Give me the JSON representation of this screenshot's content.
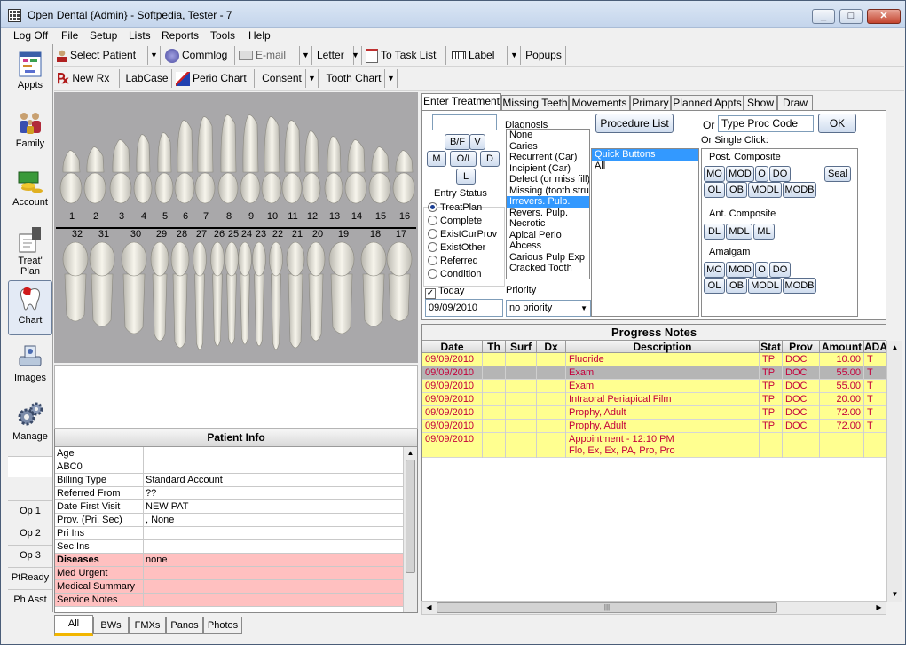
{
  "window": {
    "title": "Open Dental {Admin} - Softpedia, Tester - 7",
    "controls": [
      "_",
      "□",
      "✕"
    ]
  },
  "menu": [
    "Log Off",
    "File",
    "Setup",
    "Lists",
    "Reports",
    "Tools",
    "Help"
  ],
  "toolbar1": {
    "select_patient": "Select Patient",
    "commlog": "Commlog",
    "email": "E-mail",
    "letter": "Letter",
    "to_task_list": "To Task List",
    "label": "Label",
    "popups": "Popups"
  },
  "toolbar2": {
    "new_rx": "New Rx",
    "labcase": "LabCase",
    "perio_chart": "Perio Chart",
    "consent": "Consent",
    "tooth_chart": "Tooth Chart"
  },
  "modules": [
    {
      "label": "Appts",
      "icon": "calendar-icon"
    },
    {
      "label": "Family",
      "icon": "family-icon"
    },
    {
      "label": "Account",
      "icon": "money-icon"
    },
    {
      "label": "Treat' Plan",
      "icon": "treatplan-icon"
    },
    {
      "label": "Chart",
      "icon": "tooth-icon",
      "selected": true
    },
    {
      "label": "Images",
      "icon": "scanner-icon"
    },
    {
      "label": "Manage",
      "icon": "gears-icon"
    }
  ],
  "op_buttons": [
    "Op 1",
    "Op 2",
    "Op 3",
    "PtReady",
    "Ph Asst"
  ],
  "tooth_numbers": {
    "upper": [
      "1",
      "2",
      "3",
      "4",
      "5",
      "6",
      "7",
      "8",
      "9",
      "10",
      "11",
      "12",
      "13",
      "14",
      "15",
      "16"
    ],
    "lower": [
      "32",
      "31",
      "30",
      "29",
      "28",
      "27",
      "26",
      "25",
      "24",
      "23",
      "22",
      "21",
      "20",
      "19",
      "18",
      "17"
    ]
  },
  "patient_info": {
    "title": "Patient Info",
    "rows": [
      {
        "k": "Age",
        "v": ""
      },
      {
        "k": "ABC0",
        "v": ""
      },
      {
        "k": "Billing Type",
        "v": "Standard Account"
      },
      {
        "k": "Referred From",
        "v": "??"
      },
      {
        "k": "Date First Visit",
        "v": "NEW PAT"
      },
      {
        "k": "Prov. (Pri, Sec)",
        "v": ", None"
      },
      {
        "k": "Pri Ins",
        "v": ""
      },
      {
        "k": "Sec Ins",
        "v": ""
      },
      {
        "k": "Diseases",
        "v": "none",
        "pink": true,
        "bold": true
      },
      {
        "k": "Med Urgent",
        "v": "",
        "pink": true
      },
      {
        "k": "Medical Summary",
        "v": "",
        "pink": true
      },
      {
        "k": "Service Notes",
        "v": "",
        "pink": true
      }
    ]
  },
  "image_tabs": [
    "All",
    "BWs",
    "FMXs",
    "Panos",
    "Photos"
  ],
  "treatment_tabs": [
    "Enter Treatment",
    "Missing Teeth",
    "Movements",
    "Primary",
    "Planned Appts",
    "Show",
    "Draw"
  ],
  "surface_buttons": [
    "B/F",
    "V",
    "M",
    "O/I",
    "D",
    "L"
  ],
  "entry_status": {
    "label": "Entry Status",
    "options": [
      "TreatPlan",
      "Complete",
      "ExistCurProv",
      "ExistOther",
      "Referred",
      "Condition"
    ],
    "selected": "TreatPlan"
  },
  "today": {
    "label": "Today",
    "date": "09/09/2010",
    "checked": true
  },
  "diagnosis": {
    "label": "Diagnosis",
    "items": [
      "None",
      "Caries",
      "Recurrent (Car)",
      "Incipient (Car)",
      "Defect (or miss fill)",
      "Missing (tooth struc",
      "Irrevers. Pulp.",
      "Revers. Pulp.",
      "Necrotic",
      "Apical Perio",
      "Abcess",
      "Carious Pulp Exp",
      "Cracked Tooth"
    ],
    "selected": "Irrevers. Pulp."
  },
  "priority": {
    "label": "Priority",
    "value": "no priority"
  },
  "procedure_list": "Procedure List",
  "quick_list": {
    "items": [
      "Quick Buttons",
      "All"
    ],
    "selected": "Quick Buttons"
  },
  "or_label": "Or",
  "proc_code_placeholder": "Type Proc Code",
  "ok": "OK",
  "single_click_label": "Or Single Click:",
  "post_composite": {
    "label": "Post. Composite",
    "row1": [
      "MO",
      "MOD",
      "O",
      "DO"
    ],
    "seal": "Seal",
    "row2": [
      "OL",
      "OB",
      "MODL",
      "MODB"
    ]
  },
  "ant_composite": {
    "label": "Ant. Composite",
    "row1": [
      "DL",
      "MDL",
      "ML"
    ]
  },
  "amalgam": {
    "label": "Amalgam",
    "row1": [
      "MO",
      "MOD",
      "O",
      "DO"
    ],
    "row2": [
      "OL",
      "OB",
      "MODL",
      "MODB"
    ]
  },
  "progress_notes": {
    "title": "Progress Notes",
    "columns": [
      "Date",
      "Th",
      "Surf",
      "Dx",
      "Description",
      "Stat",
      "Prov",
      "Amount",
      "ADA C"
    ],
    "rows": [
      {
        "date": "09/09/2010",
        "th": "",
        "surf": "",
        "dx": "",
        "desc": "Fluoride",
        "stat": "TP",
        "prov": "DOC",
        "amount": "10.00",
        "ada": "T",
        "style": "y"
      },
      {
        "date": "09/09/2010",
        "th": "",
        "surf": "",
        "dx": "",
        "desc": "Exam",
        "stat": "TP",
        "prov": "DOC",
        "amount": "55.00",
        "ada": "T",
        "style": "g"
      },
      {
        "date": "09/09/2010",
        "th": "",
        "surf": "",
        "dx": "",
        "desc": "Exam",
        "stat": "TP",
        "prov": "DOC",
        "amount": "55.00",
        "ada": "T",
        "style": "y"
      },
      {
        "date": "09/09/2010",
        "th": "",
        "surf": "",
        "dx": "",
        "desc": "Intraoral Periapical Film",
        "stat": "TP",
        "prov": "DOC",
        "amount": "20.00",
        "ada": "T",
        "style": "y"
      },
      {
        "date": "09/09/2010",
        "th": "",
        "surf": "",
        "dx": "",
        "desc": "Prophy, Adult",
        "stat": "TP",
        "prov": "DOC",
        "amount": "72.00",
        "ada": "T",
        "style": "y"
      },
      {
        "date": "09/09/2010",
        "th": "",
        "surf": "",
        "dx": "",
        "desc": "Prophy, Adult",
        "stat": "TP",
        "prov": "DOC",
        "amount": "72.00",
        "ada": "T",
        "style": "y"
      }
    ],
    "appointment": {
      "date": "09/09/2010",
      "line1": "Appointment - 12:10 PM",
      "line2": "Flo, Ex, Ex, PA, Pro, Pro"
    }
  },
  "scroll_glyph": "|||"
}
